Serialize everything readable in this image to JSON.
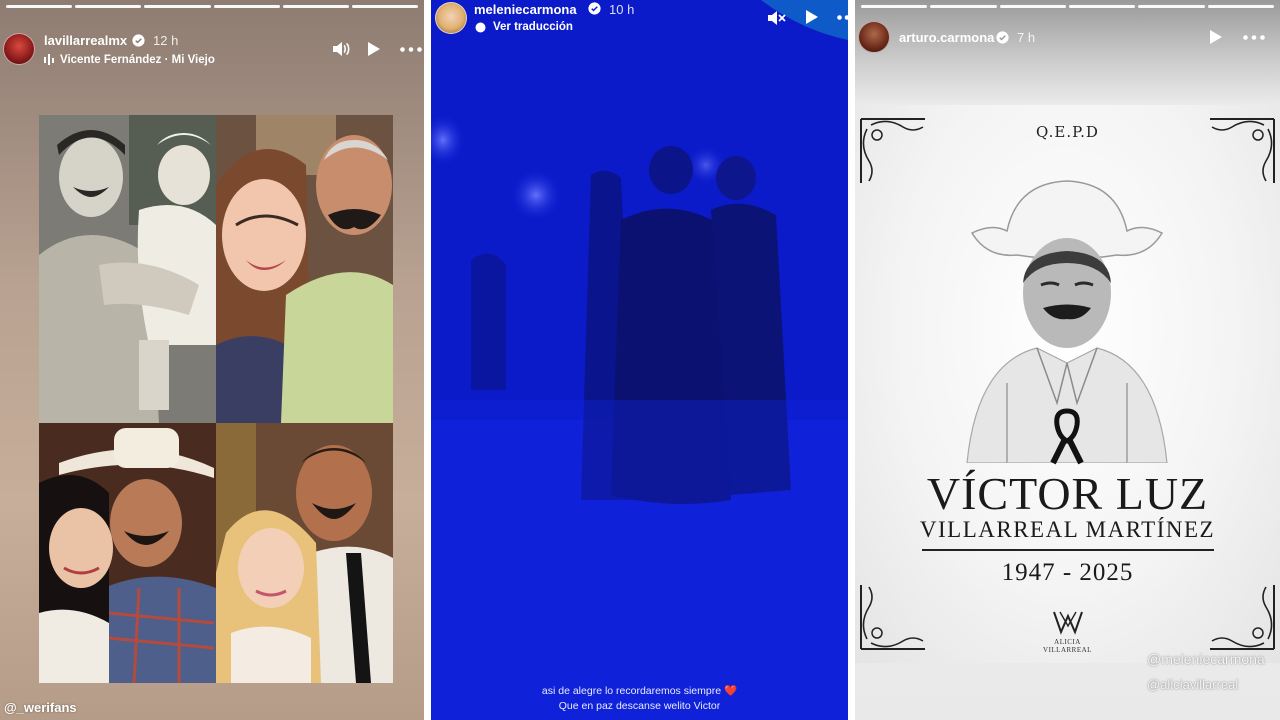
{
  "stories": [
    {
      "username": "lavillarrealmx",
      "time": "12 h",
      "music": "Vicente Fernández · Mi Viejo",
      "watermark": "@_werifans",
      "icons": [
        "verified-icon",
        "music-bars-icon",
        "volume-icon",
        "play-icon",
        "more-icon"
      ],
      "progress_segments": 6
    },
    {
      "username": "meleniecarmona",
      "time": "10 h",
      "translate_label": "Ver traducción",
      "caption_line1": "asi de alegre lo recordaremos siempre",
      "caption_line2": "Que en paz descanse welito Victor",
      "icons": [
        "verified-icon",
        "translate-icon",
        "muted-icon",
        "play-icon",
        "more-icon",
        "heart-emoji"
      ]
    },
    {
      "username": "arturo.carmona",
      "time": "7 h",
      "icons": [
        "verified-icon",
        "play-icon",
        "more-icon"
      ],
      "progress_segments": 6,
      "memorial": {
        "qepd": "Q.E.P.D",
        "name_line1": "VÍCTOR LUZ",
        "name_line2": "VILLARREAL MARTÍNEZ",
        "years": "1947 - 2025",
        "logo_line1": "ALICIA",
        "logo_line2": "VILLARREAL"
      },
      "mention1": "@meleniecarmona",
      "mention2": "@aliciavillarreal"
    }
  ],
  "colors": {
    "story1_bg": "#b9a291",
    "story2_bg": "#1020d8",
    "story3_bg": "#e9e9e9",
    "heart": "#e0342e"
  }
}
